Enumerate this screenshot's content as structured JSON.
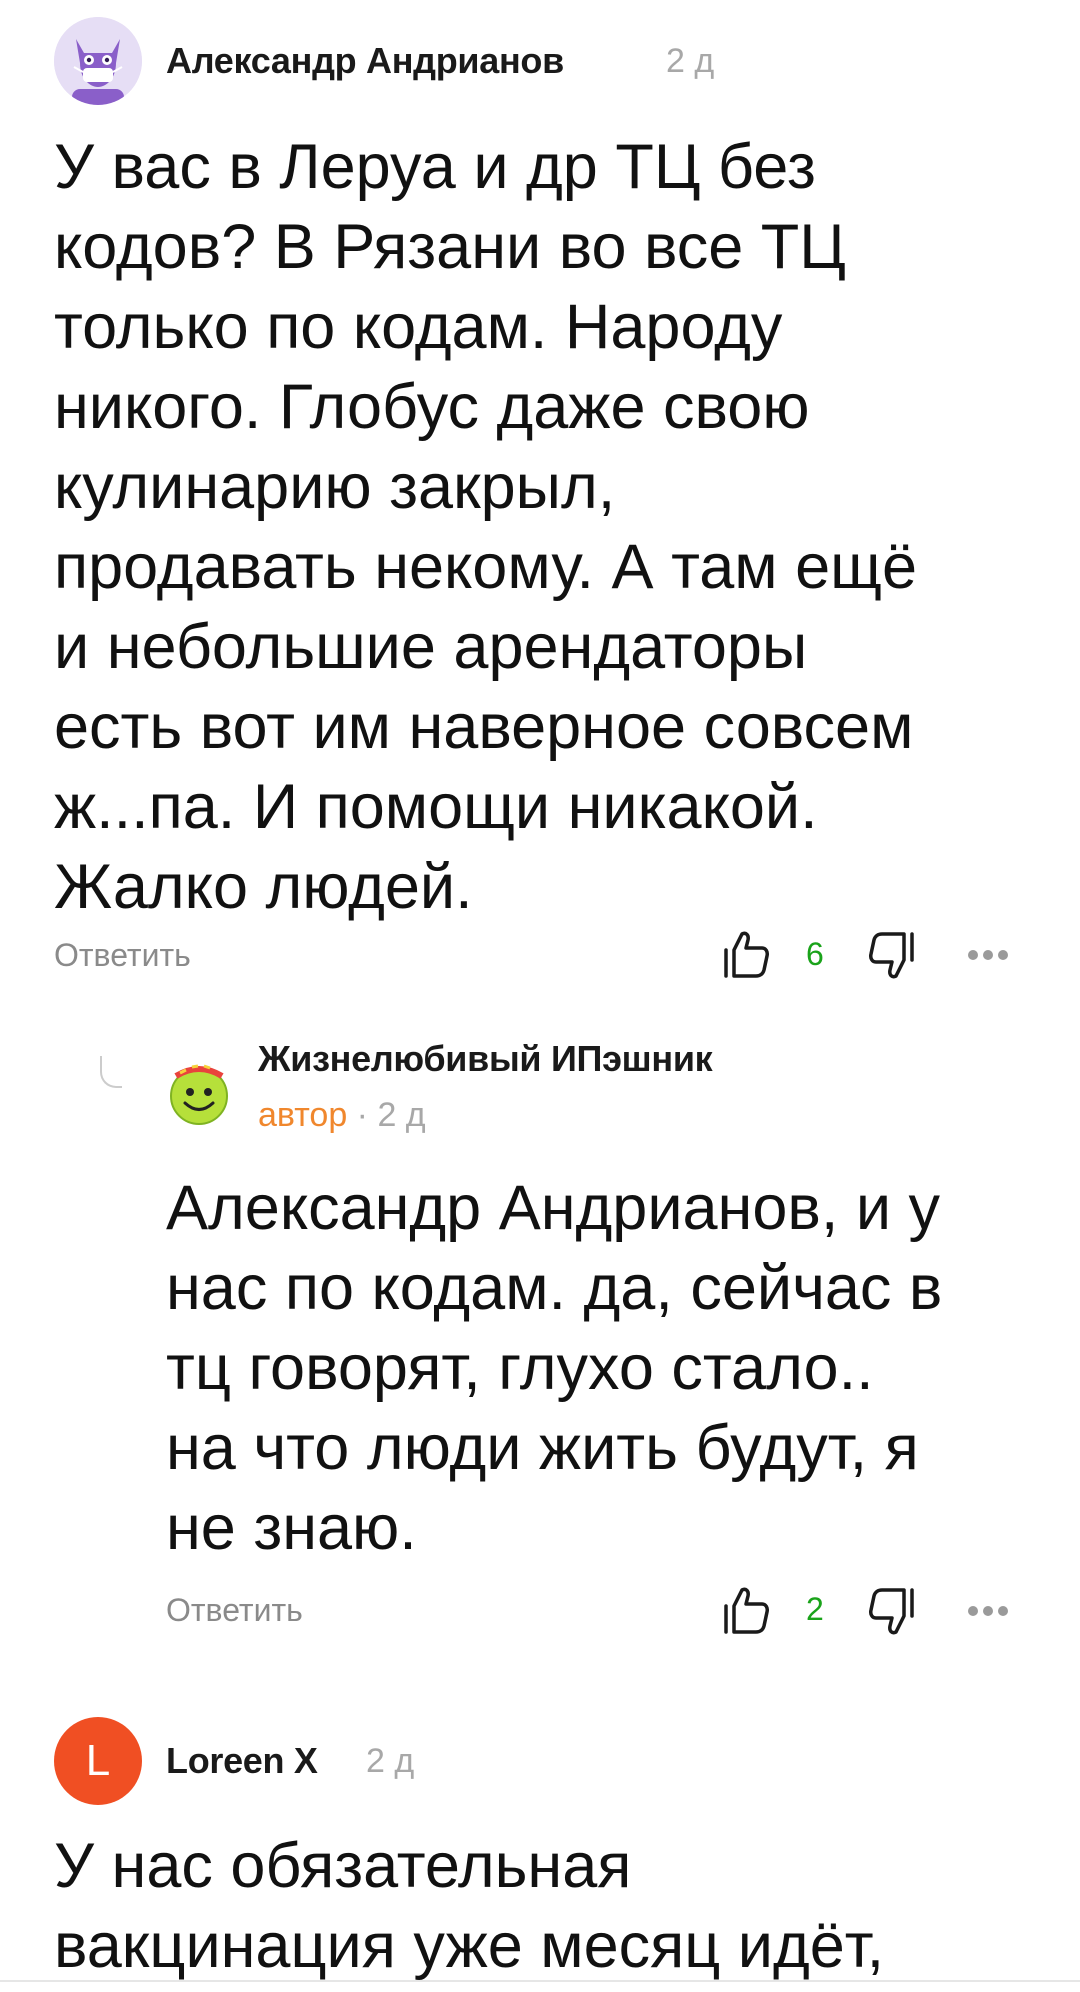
{
  "colors": {
    "author_badge": "#f0872d",
    "like_count": "#1aa31a",
    "muted": "#8a8a8a",
    "loreen_avatar": "#f04f23"
  },
  "comments": [
    {
      "author": "Александр Андрианов",
      "time": "2 д",
      "avatar_icon": "cat-with-mask-avatar",
      "text": "У вас в Леруа и др ТЦ без\nкодов? В Рязани во все ТЦ\nтолько по кодам. Народу\nникого. Глобус даже свою\nкулинарию закрыл,\nпродавать некому. А там ещё\nи небольшие арендаторы\nесть вот им наверное совсем\nж...па. И помощи никакой.\nЖалко людей.",
      "reply_label": "Ответить",
      "likes": "6"
    },
    {
      "author": "Жизнелюбивый ИПэшник",
      "badge": "автор",
      "time": "2 д",
      "avatar_icon": "smiley-face-avatar",
      "text": "Александр Андрианов, и у\nнас по кодам. да, сейчас в\nтц говорят, глухо стало..\nна что люди жить будут, я\nне знаю.",
      "reply_label": "Ответить",
      "likes": "2"
    },
    {
      "author": "Loreen X",
      "time": "2 д",
      "avatar_letter": "L",
      "text": "У нас обязательная\nвакцинация уже месяц идёт,"
    }
  ]
}
